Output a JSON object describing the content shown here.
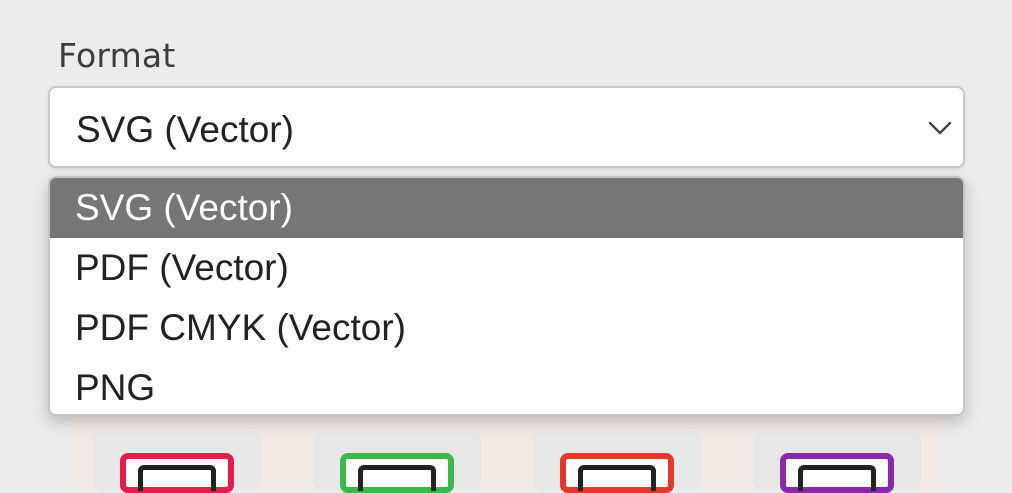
{
  "format_field": {
    "label": "Format",
    "selected_value": "SVG (Vector)",
    "expanded": true,
    "options": [
      {
        "label": "SVG (Vector)",
        "selected": true
      },
      {
        "label": "PDF (Vector)",
        "selected": false
      },
      {
        "label": "PDF CMYK (Vector)",
        "selected": false
      },
      {
        "label": "PNG",
        "selected": false
      }
    ]
  },
  "icons": {
    "dropdown_indicator": "chevron-down-icon"
  },
  "theme_cards": [
    {
      "accent": "#e0204a"
    },
    {
      "accent": "#3cb84a"
    },
    {
      "accent": "#e5372b"
    },
    {
      "accent": "#8a2aa8"
    }
  ],
  "colors": {
    "page_background": "#ececec",
    "selected_option_background": "#767676",
    "selected_option_text": "#ffffff"
  }
}
